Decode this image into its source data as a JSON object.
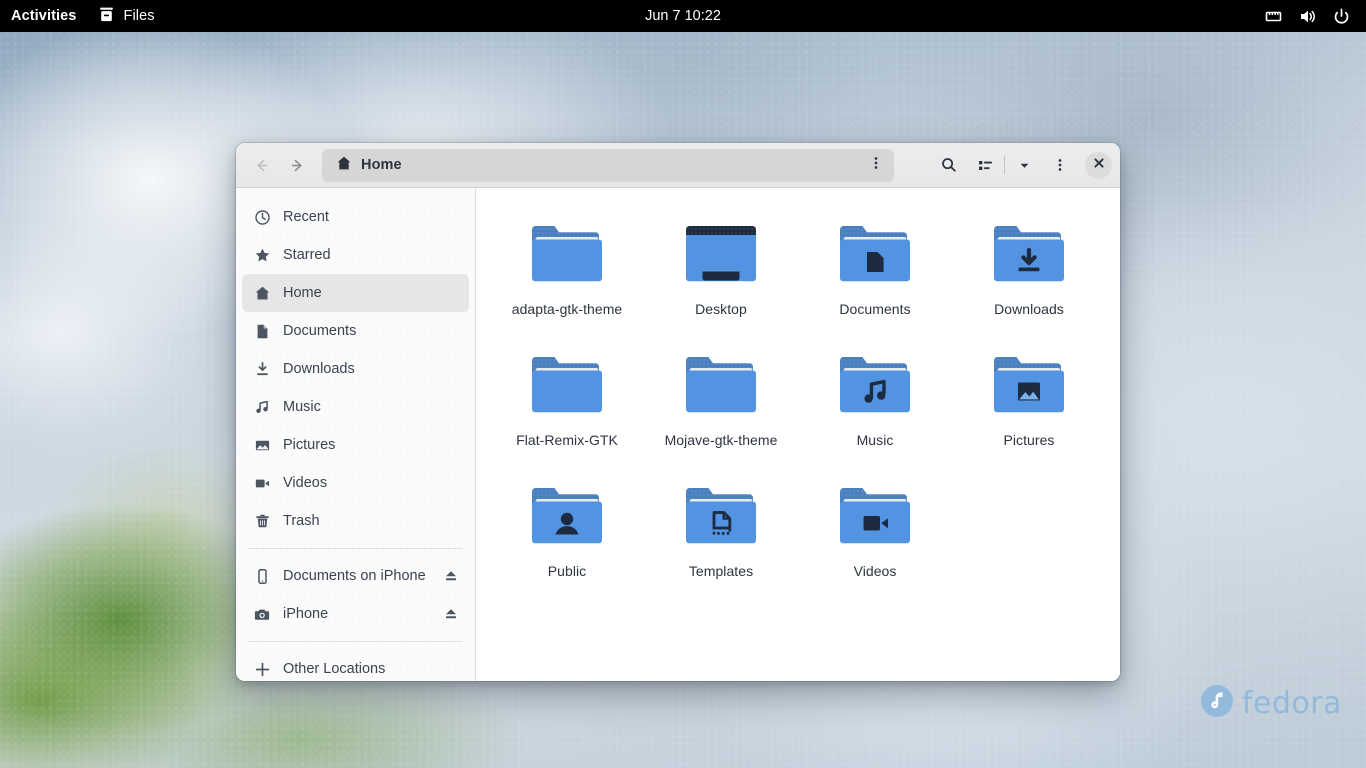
{
  "topbar": {
    "activities_label": "Activities",
    "app_label": "Files",
    "app_icon": "files-icon",
    "clock": "Jun 7  10:22",
    "status_icons": [
      "network-wired-icon",
      "volume-icon",
      "power-icon"
    ]
  },
  "window": {
    "title": "Home",
    "path_icon": "home-icon",
    "nav": {
      "back": "back-icon",
      "forward": "forward-icon"
    },
    "header_actions": [
      {
        "name": "pathbar-menu-button",
        "icon": "kebab-menu-icon"
      },
      {
        "name": "search-button",
        "icon": "search-icon"
      },
      {
        "name": "view-mode-button",
        "icon": "list-view-icon"
      },
      {
        "name": "view-options-button",
        "icon": "chevron-down-icon"
      },
      {
        "name": "main-menu-button",
        "icon": "kebab-menu-icon"
      },
      {
        "name": "close-button",
        "icon": "close-icon"
      }
    ]
  },
  "sidebar": {
    "groups": [
      {
        "items": [
          {
            "label": "Recent",
            "icon": "clock-icon",
            "selected": false,
            "eject": false
          },
          {
            "label": "Starred",
            "icon": "star-icon",
            "selected": false,
            "eject": false
          },
          {
            "label": "Home",
            "icon": "home-icon",
            "selected": true,
            "eject": false
          },
          {
            "label": "Documents",
            "icon": "document-icon",
            "selected": false,
            "eject": false
          },
          {
            "label": "Downloads",
            "icon": "download-icon",
            "selected": false,
            "eject": false
          },
          {
            "label": "Music",
            "icon": "music-icon",
            "selected": false,
            "eject": false
          },
          {
            "label": "Pictures",
            "icon": "image-icon",
            "selected": false,
            "eject": false
          },
          {
            "label": "Videos",
            "icon": "video-icon",
            "selected": false,
            "eject": false
          },
          {
            "label": "Trash",
            "icon": "trash-icon",
            "selected": false,
            "eject": false
          }
        ]
      },
      {
        "items": [
          {
            "label": "Documents on iPhone",
            "icon": "phone-icon",
            "selected": false,
            "eject": true
          },
          {
            "label": "iPhone",
            "icon": "camera-icon",
            "selected": false,
            "eject": true
          }
        ]
      },
      {
        "items": [
          {
            "label": "Other Locations",
            "icon": "plus-icon",
            "selected": false,
            "eject": false
          }
        ]
      }
    ]
  },
  "files": [
    {
      "name": "adapta-gtk-theme",
      "icon": "folder-plain"
    },
    {
      "name": "Desktop",
      "icon": "folder-desktop"
    },
    {
      "name": "Documents",
      "icon": "folder-documents"
    },
    {
      "name": "Downloads",
      "icon": "folder-downloads"
    },
    {
      "name": "Flat-Remix-GTK",
      "icon": "folder-plain"
    },
    {
      "name": "Mojave-gtk-theme",
      "icon": "folder-plain"
    },
    {
      "name": "Music",
      "icon": "folder-music"
    },
    {
      "name": "Pictures",
      "icon": "folder-pictures"
    },
    {
      "name": "Public",
      "icon": "folder-public"
    },
    {
      "name": "Templates",
      "icon": "folder-templates"
    },
    {
      "name": "Videos",
      "icon": "folder-videos"
    }
  ],
  "watermark": {
    "text": "fedora",
    "icon": "fedora-logo",
    "color": "#8fb8dd"
  },
  "colors": {
    "topbar_bg": "#000000",
    "headerbar_bg": "#ededed",
    "sidebar_bg": "#fbfbfb",
    "selected_bg": "#e6e6e6",
    "folder_blue": "#5294e2",
    "folder_tab": "#4a80c0",
    "emblem_dark": "#1d2b40",
    "content_bg": "#ffffff"
  }
}
